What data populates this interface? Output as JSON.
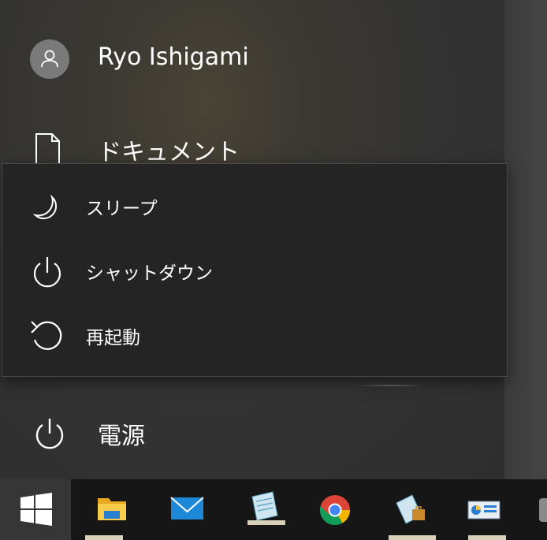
{
  "user": {
    "name": "Ryo Ishigami",
    "avatar_icon": "person-icon"
  },
  "sidebar": {
    "documents_label": "ドキュメント",
    "power_label": "電源"
  },
  "power_menu": {
    "items": [
      {
        "label": "スリープ",
        "icon": "moon-icon"
      },
      {
        "label": "シャットダウン",
        "icon": "power-icon"
      },
      {
        "label": "再起動",
        "icon": "restart-icon"
      }
    ]
  },
  "taskbar": {
    "items": [
      {
        "icon": "start-icon"
      },
      {
        "icon": "file-explorer-icon"
      },
      {
        "icon": "mail-icon"
      },
      {
        "icon": "notepad-icon"
      },
      {
        "icon": "chrome-icon"
      },
      {
        "icon": "briefcase-icon"
      },
      {
        "icon": "control-panel-icon"
      }
    ]
  },
  "colors": {
    "flyout_bg": "#242424",
    "taskbar_bg": "#161616",
    "start_button_bg": "#363636",
    "mail_blue": "#1e88d8",
    "folder_yellow": "#f0c040"
  }
}
